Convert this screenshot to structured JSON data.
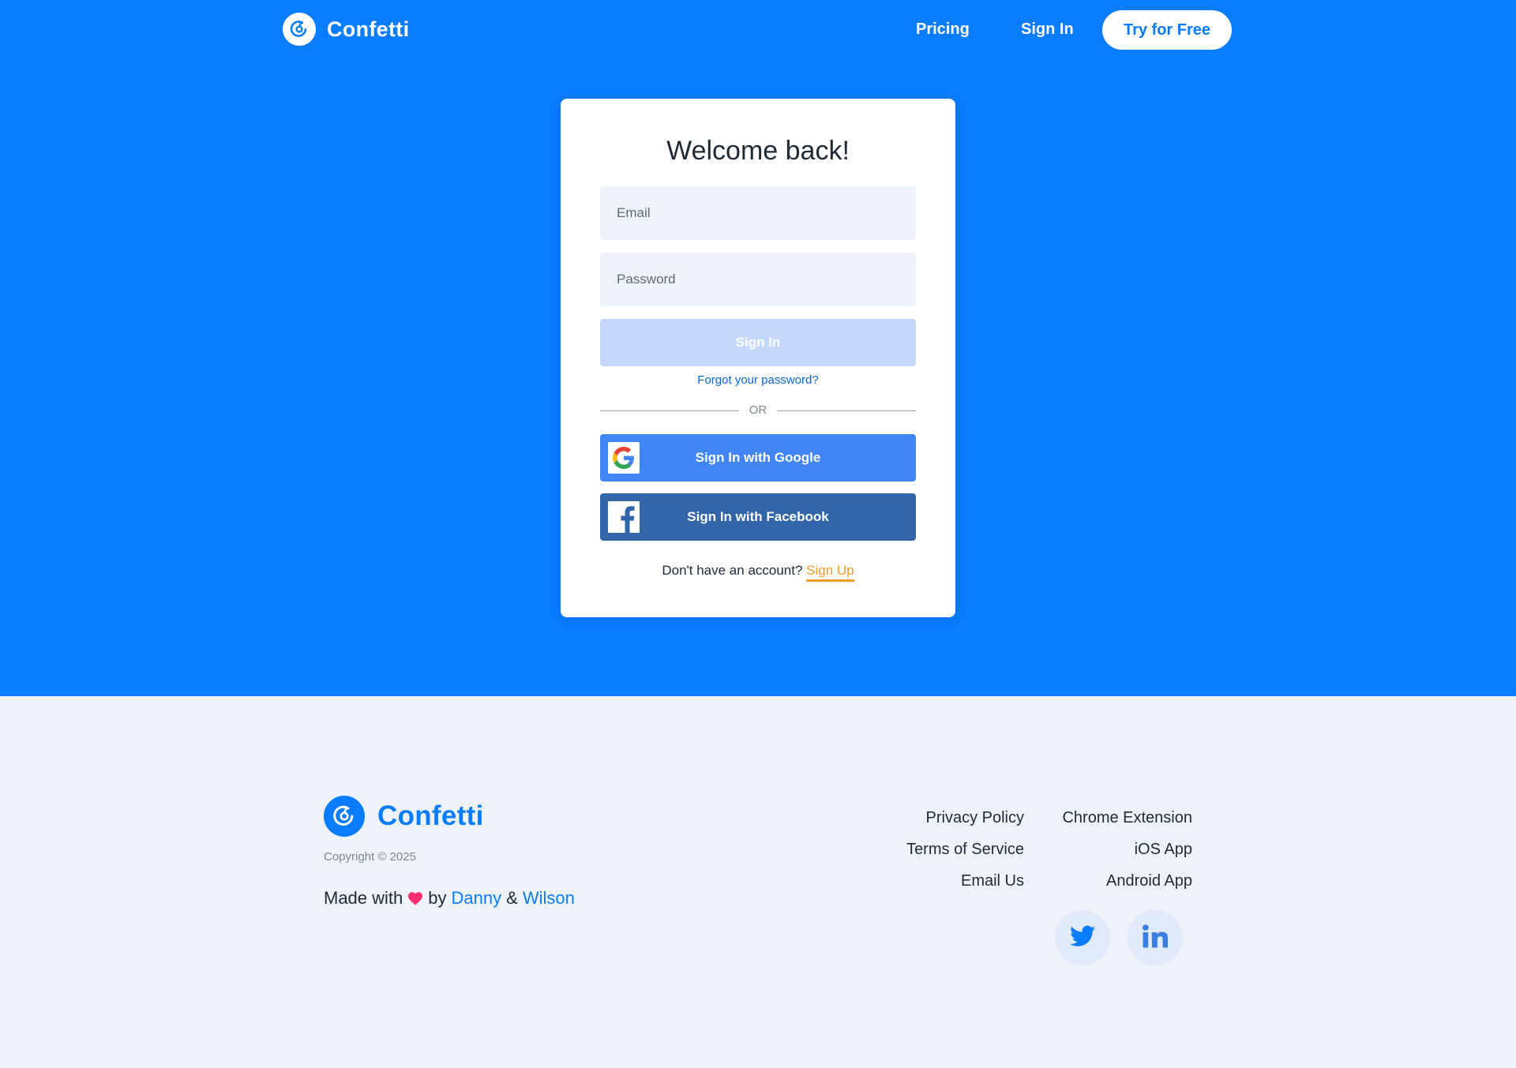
{
  "nav": {
    "brand": "Confetti",
    "pricing": "Pricing",
    "sign_in": "Sign In",
    "cta": "Try for Free"
  },
  "login": {
    "title": "Welcome back!",
    "email_placeholder": "Email",
    "password_placeholder": "Password",
    "submit": "Sign In",
    "forgot": "Forgot your password?",
    "divider": "OR",
    "google": "Sign In with Google",
    "facebook": "Sign In with Facebook",
    "no_account": "Don't have an account?",
    "sign_up": "Sign Up"
  },
  "footer": {
    "brand": "Confetti",
    "copyright": "Copyright © 2025",
    "made_with": "Made with",
    "by": "by",
    "author1": "Danny",
    "amp": "&",
    "author2": "Wilson",
    "links_col1": [
      "Privacy Policy",
      "Terms of Service",
      "Email Us"
    ],
    "links_col2": [
      "Chrome Extension",
      "iOS App",
      "Android App"
    ]
  },
  "colors": {
    "primary": "#0a7cff",
    "page_bg": "#eef3fa",
    "google": "#4286f5",
    "facebook": "#3366a8",
    "sign_up": "#f59a23",
    "heart": "#ff2d6f"
  },
  "icons": {
    "logo": "confetti-logo-icon",
    "google": "google-icon",
    "facebook": "facebook-icon",
    "heart": "heart-icon",
    "twitter": "twitter-icon",
    "linkedin": "linkedin-icon"
  }
}
